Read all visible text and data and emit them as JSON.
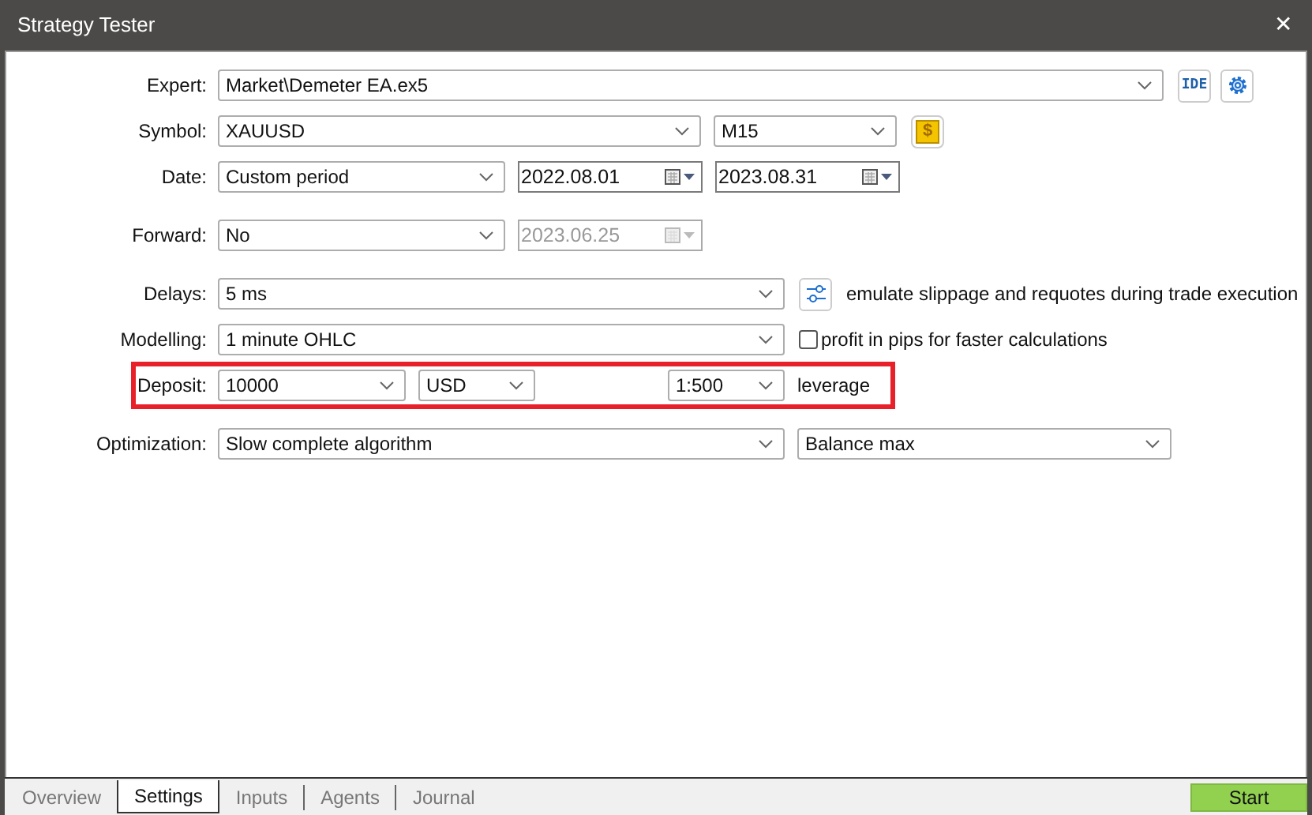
{
  "window": {
    "title": "Strategy Tester",
    "close": "✕"
  },
  "expert": {
    "label": "Expert:",
    "value": "Market\\Demeter EA.ex5",
    "ide_button": "IDE"
  },
  "symbol": {
    "label": "Symbol:",
    "value": "XAUUSD",
    "timeframe": "M15",
    "currency_button": "$"
  },
  "date": {
    "label": "Date:",
    "value": "Custom period",
    "from": "2022.08.01",
    "to": "2023.08.31"
  },
  "forward": {
    "label": "Forward:",
    "value": "No",
    "date": "2023.06.25",
    "date_disabled": true
  },
  "delays": {
    "label": "Delays:",
    "value": "5 ms",
    "note": "emulate slippage and requotes during trade execution"
  },
  "modelling": {
    "label": "Modelling:",
    "value": "1 minute OHLC",
    "checkbox": {
      "label": "profit in pips for faster calculations",
      "checked": false
    }
  },
  "deposit": {
    "label": "Deposit:",
    "value": "10000",
    "currency": "USD",
    "leverage": "1:500",
    "leverage_label": "leverage",
    "highlighted": true
  },
  "optimization": {
    "label": "Optimization:",
    "value": "Slow complete algorithm",
    "criterion": "Balance max"
  },
  "tabs": [
    {
      "label": "Overview",
      "selected": false
    },
    {
      "label": "Settings",
      "selected": true
    },
    {
      "label": "Inputs",
      "selected": false
    },
    {
      "label": "Agents",
      "selected": false
    },
    {
      "label": "Journal",
      "selected": false
    }
  ],
  "start_button": "Start"
}
